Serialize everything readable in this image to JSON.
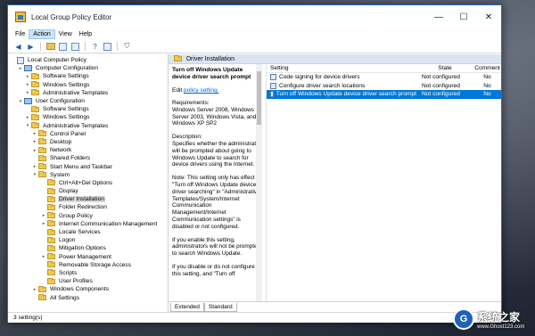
{
  "window": {
    "title": "Local Group Policy Editor",
    "controls": {
      "minimize": "—",
      "maximize": "☐",
      "close": "✕"
    }
  },
  "menu": [
    "File",
    "Action",
    "View",
    "Help"
  ],
  "tree": [
    {
      "label": "Local Computer Policy",
      "indent": 0,
      "arrow": "",
      "icon": "policy"
    },
    {
      "label": "Computer Configuration",
      "indent": 1,
      "arrow": "▸",
      "icon": "computer"
    },
    {
      "label": "Software Settings",
      "indent": 2,
      "arrow": "▸",
      "icon": "folder"
    },
    {
      "label": "Windows Settings",
      "indent": 2,
      "arrow": "▸",
      "icon": "folder"
    },
    {
      "label": "Administrative Templates",
      "indent": 2,
      "arrow": "▸",
      "icon": "folder"
    },
    {
      "label": "User Configuration",
      "indent": 1,
      "arrow": "▾",
      "icon": "computer"
    },
    {
      "label": "Software Settings",
      "indent": 2,
      "arrow": "",
      "icon": "folder"
    },
    {
      "label": "Windows Settings",
      "indent": 2,
      "arrow": "▸",
      "icon": "folder"
    },
    {
      "label": "Administrative Templates",
      "indent": 2,
      "arrow": "▾",
      "icon": "folder"
    },
    {
      "label": "Control Panel",
      "indent": 3,
      "arrow": "▸",
      "icon": "folder"
    },
    {
      "label": "Desktop",
      "indent": 3,
      "arrow": "▸",
      "icon": "folder"
    },
    {
      "label": "Network",
      "indent": 3,
      "arrow": "▸",
      "icon": "folder"
    },
    {
      "label": "Shared Folders",
      "indent": 3,
      "arrow": "",
      "icon": "folder"
    },
    {
      "label": "Start Menu and Taskbar",
      "indent": 3,
      "arrow": "▸",
      "icon": "folder"
    },
    {
      "label": "System",
      "indent": 3,
      "arrow": "▾",
      "icon": "folder"
    },
    {
      "label": "Ctrl+Alt+Del Options",
      "indent": 4,
      "arrow": "",
      "icon": "folder"
    },
    {
      "label": "Display",
      "indent": 4,
      "arrow": "",
      "icon": "folder"
    },
    {
      "label": "Driver Installation",
      "indent": 4,
      "arrow": "",
      "icon": "folder",
      "selected": true
    },
    {
      "label": "Folder Redirection",
      "indent": 4,
      "arrow": "",
      "icon": "folder"
    },
    {
      "label": "Group Policy",
      "indent": 4,
      "arrow": "▸",
      "icon": "folder"
    },
    {
      "label": "Internet Communication Management",
      "indent": 4,
      "arrow": "▸",
      "icon": "folder"
    },
    {
      "label": "Locale Services",
      "indent": 4,
      "arrow": "",
      "icon": "folder"
    },
    {
      "label": "Logon",
      "indent": 4,
      "arrow": "",
      "icon": "folder"
    },
    {
      "label": "Mitigation Options",
      "indent": 4,
      "arrow": "",
      "icon": "folder"
    },
    {
      "label": "Power Management",
      "indent": 4,
      "arrow": "▸",
      "icon": "folder"
    },
    {
      "label": "Removable Storage Access",
      "indent": 4,
      "arrow": "",
      "icon": "folder"
    },
    {
      "label": "Scripts",
      "indent": 4,
      "arrow": "",
      "icon": "folder"
    },
    {
      "label": "User Profiles",
      "indent": 4,
      "arrow": "",
      "icon": "folder"
    },
    {
      "label": "Windows Components",
      "indent": 3,
      "arrow": "▸",
      "icon": "folder"
    },
    {
      "label": "All Settings",
      "indent": 3,
      "arrow": "",
      "icon": "folder"
    }
  ],
  "path_header": "Driver Installation",
  "description": {
    "title": "Turn off Windows Update device driver search prompt",
    "edit_prefix": "Edit",
    "edit_link": "policy setting.",
    "blocks": [
      "Requirements:\nWindows Server 2008, Windows Server 2003, Windows Vista, and Windows XP SP2",
      "Description:\nSpecifies whether the administrator will be prompted about going to Windows Update to search for device drivers using the Internet.",
      "Note: This setting only has effect if \"Turn off Windows Update device driver searching\" in \"Administrative Templates/System/Internet Communication Management/Internet Communication settings\" is disabled or not configured.",
      "If you enable this setting, administrators will not be prompted to search Windows Update.",
      "If you disable or do not configure this setting, and \"Turn off"
    ]
  },
  "settings": {
    "columns": {
      "setting": "Setting",
      "state": "State",
      "comment": "Comment"
    },
    "rows": [
      {
        "setting": "Code signing for device drivers",
        "state": "Not configured",
        "comment": "No"
      },
      {
        "setting": "Configure driver search locations",
        "state": "Not configured",
        "comment": "No"
      },
      {
        "setting": "Turn off Windows Update device driver search prompt",
        "state": "Not configured",
        "comment": "No",
        "selected": true
      }
    ]
  },
  "tabs": [
    "Extended",
    "Standard"
  ],
  "status": "3 setting(s)",
  "watermark": {
    "logo": "G",
    "name": "系统之家",
    "url": "www.Ghost123.com"
  },
  "colors": {
    "selection": "#0078d7",
    "accent": "#1e72c8",
    "header": "#dbe5f1"
  }
}
